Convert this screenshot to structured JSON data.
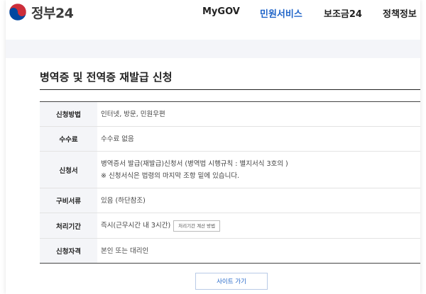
{
  "header": {
    "logo_text": "정부24",
    "nav": [
      {
        "label": "MyGOV",
        "active": false
      },
      {
        "label": "민원서비스",
        "active": true
      },
      {
        "label": "보조금24",
        "active": false
      },
      {
        "label": "정책정보",
        "active": false
      }
    ]
  },
  "page_title": "병역증 및 전역증 재발급 신청",
  "info_rows": [
    {
      "label": "신청방법",
      "lines": [
        "인터넷, 방문, 민원우편"
      ]
    },
    {
      "label": "수수료",
      "lines": [
        "수수료 없음"
      ]
    },
    {
      "label": "신청서",
      "lines": [
        "병역증서 발급(재발급)신청서 (병역법 시행규칙 : 별지서식 3호의 )",
        "※ 신청서식은 법령의 마지막 조항 밑에 있습니다."
      ]
    },
    {
      "label": "구비서류",
      "lines": [
        "있음 (하단참조)"
      ]
    },
    {
      "label": "처리기간",
      "lines": [
        "즉시(근무시간 내 3시간)"
      ],
      "button": "처리기간 계산 방법"
    },
    {
      "label": "신청자격",
      "lines": [
        "본인 또는 대리인"
      ]
    }
  ],
  "site_button": "사이트 가기",
  "colors": {
    "accent": "#1f64c8",
    "logo_red": "#cd2e3a",
    "logo_blue": "#0047a0",
    "band": "#f4f5f9",
    "label_bg": "#f4f5f8"
  },
  "icons": {
    "logo": "taegeuk-emblem-icon"
  }
}
